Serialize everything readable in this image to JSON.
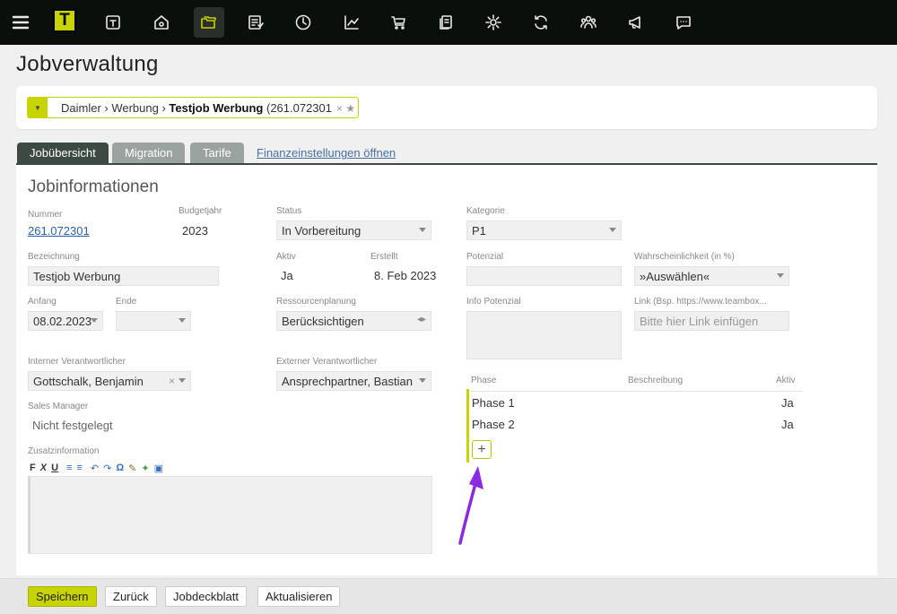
{
  "nav": {
    "brand": "T",
    "icons": [
      "menu-icon",
      "brand-logo",
      "calendar-t-icon",
      "home-location-icon",
      "folder-copy-icon",
      "checklist-icon",
      "clock-icon",
      "chart-icon",
      "cart-icon",
      "documents-icon",
      "settings-icon",
      "refresh-icon",
      "team-icon",
      "megaphone-icon",
      "chat-icon"
    ],
    "active": "folder-copy-icon"
  },
  "page": {
    "title": "Jobverwaltung"
  },
  "selector": {
    "path": "Daimler › Werbung › ",
    "job": "Testjob Werbung",
    "suffix": " (261.072301",
    "clear": "× ★"
  },
  "tabs": [
    {
      "label": "Jobübersicht",
      "active": true
    },
    {
      "label": "Migration",
      "active": false
    },
    {
      "label": "Tarife",
      "active": false
    }
  ],
  "tab_link": "Finanzeinstellungen öffnen",
  "section_title": "Jobinformationen",
  "fields": {
    "nummer": {
      "label": "Nummer",
      "value": "261.072301"
    },
    "budgetjahr": {
      "label": "Budgetjahr",
      "value": "2023"
    },
    "status": {
      "label": "Status",
      "value": "In Vorbereitung"
    },
    "kategorie": {
      "label": "Kategorie",
      "value": "P1"
    },
    "bezeichnung": {
      "label": "Bezeichnung",
      "value": "Testjob Werbung"
    },
    "aktiv": {
      "label": "Aktiv",
      "value": "Ja"
    },
    "erstellt": {
      "label": "Erstellt",
      "value": "8. Feb 2023"
    },
    "potenzial": {
      "label": "Potenzial",
      "value": ""
    },
    "wahrscheinlichkeit": {
      "label": "Wahrscheinlichkeit (in %)",
      "value": "»Auswählen«"
    },
    "anfang": {
      "label": "Anfang",
      "value": "08.02.2023"
    },
    "ende": {
      "label": "Ende",
      "value": ""
    },
    "ressourcen": {
      "label": "Ressourcenplanung",
      "value": "Berücksichtigen"
    },
    "info_potenzial": {
      "label": "Info Potenzial"
    },
    "link": {
      "label": "Link (Bsp. https://www.teambox...",
      "placeholder": "Bitte hier Link einfügen"
    },
    "interner": {
      "label": "Interner Verantwortlicher",
      "value": "Gottschalk, Benjamin"
    },
    "externer": {
      "label": "Externer Verantwortlicher",
      "value": "Ansprechpartner, Bastian"
    },
    "sales": {
      "label": "Sales Manager",
      "value": "Nicht festgelegt"
    },
    "zusatz": {
      "label": "Zusatzinformation"
    }
  },
  "editor_toolbar": [
    "F",
    "X",
    "U",
    "≡",
    "≡",
    "↶",
    "↷",
    "Ω",
    "✎",
    "✦",
    "▣"
  ],
  "phases": {
    "headers": {
      "phase": "Phase",
      "beschreibung": "Beschreibung",
      "aktiv": "Aktiv"
    },
    "rows": [
      {
        "phase": "Phase 1",
        "aktiv": "Ja"
      },
      {
        "phase": "Phase 2",
        "aktiv": "Ja"
      }
    ],
    "add": "+"
  },
  "buttons": {
    "save": "Speichern",
    "back": "Zurück",
    "cover": "Jobdeckblatt",
    "refresh": "Aktualisieren"
  },
  "colors": {
    "accent": "#c8d400",
    "annotation": "#8a2be2",
    "tab_active": "#3d4a44"
  }
}
